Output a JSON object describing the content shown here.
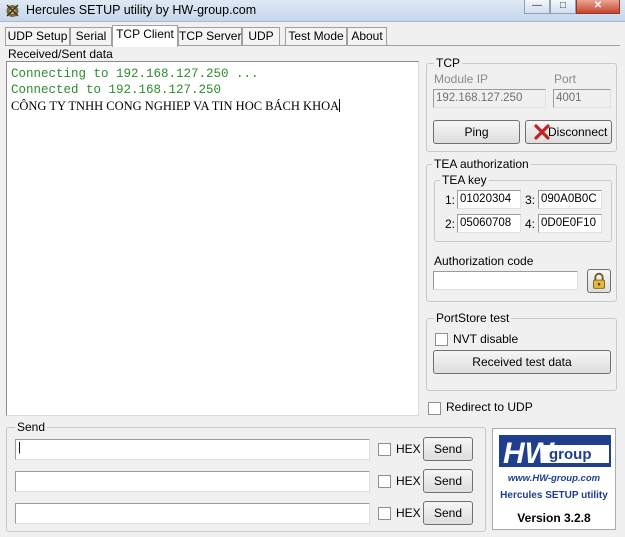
{
  "window": {
    "title": "Hercules SETUP utility by HW-group.com"
  },
  "tabs": [
    {
      "label": "UDP Setup"
    },
    {
      "label": "Serial"
    },
    {
      "label": "TCP Client"
    },
    {
      "label": "TCP Server"
    },
    {
      "label": "UDP"
    },
    {
      "label": "Test Mode"
    },
    {
      "label": "About"
    }
  ],
  "log": {
    "label": "Received/Sent data",
    "lines": [
      "Connecting to 192.168.127.250 ...",
      "Connected to 192.168.127.250",
      "CÔNG TY TNHH CONG NGHIEP VA TIN HOC BÁCH KHOA"
    ]
  },
  "tcp": {
    "title": "TCP",
    "module_ip_label": "Module IP",
    "module_ip": "192.168.127.250",
    "port_label": "Port",
    "port": "4001",
    "ping_label": "Ping",
    "disconnect_label": "Disconnect"
  },
  "tea": {
    "title": "TEA authorization",
    "key_title": "TEA key",
    "k1_label": "1:",
    "k1": "01020304",
    "k2_label": "2:",
    "k2": "05060708",
    "k3_label": "3:",
    "k3": "090A0B0C",
    "k4_label": "4:",
    "k4": "0D0E0F10",
    "auth_label": "Authorization code",
    "auth_value": ""
  },
  "portstore": {
    "title": "PortStore test",
    "nvt_label": "NVT disable",
    "received_btn": "Received test data"
  },
  "redirect_label": "Redirect to UDP",
  "send": {
    "title": "Send",
    "rows": [
      {
        "value": "|",
        "hex_label": "HEX",
        "button": "Send"
      },
      {
        "value": "",
        "hex_label": "HEX",
        "button": "Send"
      },
      {
        "value": "",
        "hex_label": "HEX",
        "button": "Send"
      }
    ]
  },
  "logo": {
    "hw": "HW",
    "group": "group",
    "url": "www.HW-group.com",
    "product": "Hercules SETUP utility",
    "version": "Version  3.2.8"
  }
}
